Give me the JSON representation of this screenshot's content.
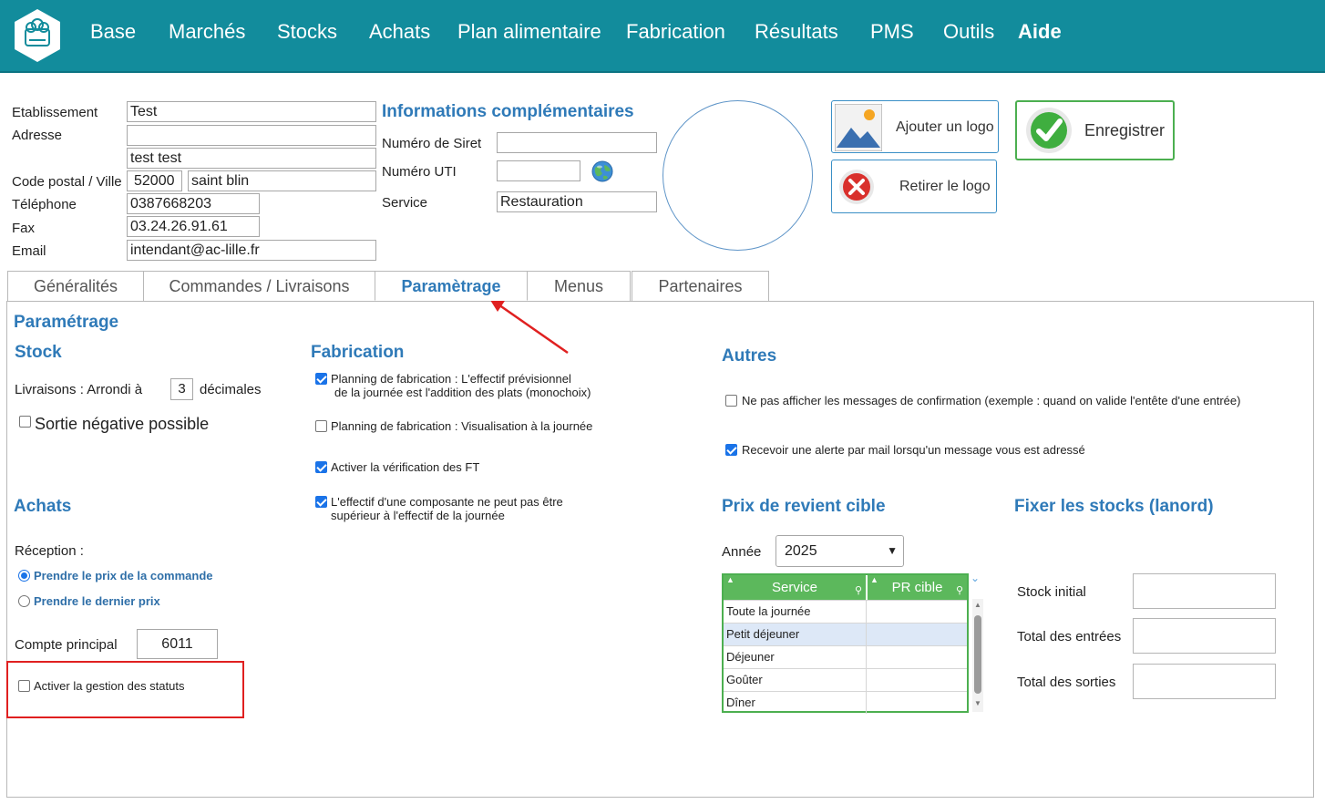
{
  "nav": {
    "items": [
      "Base",
      "Marchés",
      "Stocks",
      "Achats",
      "Plan alimentaire",
      "Fabrication",
      "Résultats",
      "PMS",
      "Outils",
      "Aide"
    ],
    "bg_color": "#128c9c"
  },
  "establishment": {
    "etablissement_label": "Etablissement",
    "etablissement_value": "Test",
    "adresse_label": "Adresse",
    "adresse_line1": "",
    "adresse_line2": "test test",
    "cp_ville_label": "Code postal / Ville",
    "code_postal": "52000",
    "ville": "saint blin",
    "telephone_label": "Téléphone",
    "telephone": "0387668203",
    "fax_label": "Fax",
    "fax": "03.24.26.91.61",
    "email_label": "Email",
    "email": "intendant@ac-lille.fr"
  },
  "info_comp": {
    "title": "Informations complémentaires",
    "siret_label": "Numéro de Siret",
    "siret_value": "",
    "uti_label": "Numéro UTI",
    "uti_value": "",
    "service_label": "Service",
    "service_value": "Restauration"
  },
  "buttons": {
    "add_logo": "Ajouter un logo",
    "remove_logo": "Retirer le logo",
    "save": "Enregistrer"
  },
  "tabs": [
    "Généralités",
    "Commandes / Livraisons",
    "Paramètrage",
    "Menus",
    "Partenaires"
  ],
  "active_tab": "Paramètrage",
  "param": {
    "title": "Paramétrage",
    "stock": {
      "title": "Stock",
      "livraisons_label": "Livraisons : Arrondi à",
      "decimales_value": "3",
      "decimales_label": "décimales",
      "sortie_negative_label": "Sortie négative possible",
      "sortie_negative_checked": false
    },
    "fabrication": {
      "title": "Fabrication",
      "opt1_line1": "Planning de fabrication : L'effectif prévisionnel",
      "opt1_line2": "de la journée est l'addition des plats (monochoix)",
      "opt1_checked": true,
      "opt2": "Planning de fabrication : Visualisation à la journée",
      "opt2_checked": false,
      "opt3": "Activer la vérification des FT",
      "opt3_checked": true,
      "opt4_line1": "L'effectif d'une composante ne peut pas être",
      "opt4_line2": "supérieur à l'effectif de la journée",
      "opt4_checked": true
    },
    "autres": {
      "title": "Autres",
      "opt1": "Ne pas afficher les messages de confirmation (exemple : quand on valide l'entête d'une entrée)",
      "opt1_checked": false,
      "opt2": "Recevoir une alerte par mail lorsqu'un message vous est adressé",
      "opt2_checked": true
    },
    "achats": {
      "title": "Achats",
      "reception_label": "Réception :",
      "radio1": "Prendre le prix de la commande",
      "radio1_selected": true,
      "radio2": "Prendre le dernier prix",
      "radio2_selected": false,
      "compte_label": "Compte principal",
      "compte_value": "6011",
      "statuts_label": "Activer la gestion des statuts",
      "statuts_checked": false
    },
    "prix_revient": {
      "title": "Prix de revient cible",
      "annee_label": "Année",
      "annee_value": "2025",
      "columns": [
        "Service",
        "PR cible"
      ],
      "rows": [
        {
          "service": "Toute la journée",
          "pr": ""
        },
        {
          "service": "Petit déjeuner",
          "pr": ""
        },
        {
          "service": "Déjeuner",
          "pr": ""
        },
        {
          "service": "Goûter",
          "pr": ""
        },
        {
          "service": "Dîner",
          "pr": ""
        }
      ],
      "selected_row": 1
    },
    "fixer_stocks": {
      "title": "Fixer les stocks (lanord)",
      "stock_initial_label": "Stock initial",
      "total_entrees_label": "Total des entrées",
      "total_sorties_label": "Total des sorties"
    }
  },
  "annotation_color": "#e02020"
}
